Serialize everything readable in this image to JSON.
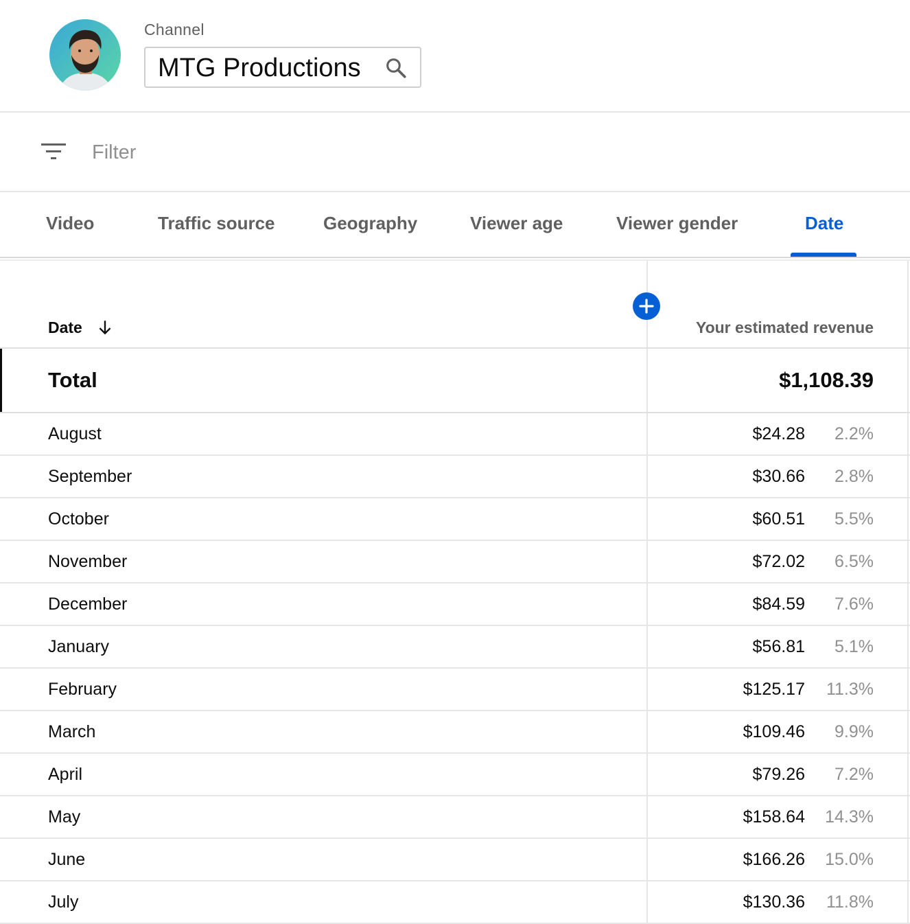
{
  "channel": {
    "label": "Channel",
    "name": "MTG Productions"
  },
  "filter": {
    "placeholder": "Filter"
  },
  "tabs": [
    {
      "label": "Video"
    },
    {
      "label": "Traffic source"
    },
    {
      "label": "Geography"
    },
    {
      "label": "Viewer age"
    },
    {
      "label": "Viewer gender"
    },
    {
      "label": "Date",
      "active": true
    }
  ],
  "table": {
    "date_header": "Date",
    "revenue_header": "Your estimated revenue",
    "total_label": "Total",
    "total_value": "$1,108.39",
    "rows": [
      {
        "label": "August",
        "value": "$24.28",
        "percent": "2.2%"
      },
      {
        "label": "September",
        "value": "$30.66",
        "percent": "2.8%"
      },
      {
        "label": "October",
        "value": "$60.51",
        "percent": "5.5%"
      },
      {
        "label": "November",
        "value": "$72.02",
        "percent": "6.5%"
      },
      {
        "label": "December",
        "value": "$84.59",
        "percent": "7.6%"
      },
      {
        "label": "January",
        "value": "$56.81",
        "percent": "5.1%"
      },
      {
        "label": "February",
        "value": "$125.17",
        "percent": "11.3%"
      },
      {
        "label": "March",
        "value": "$109.46",
        "percent": "9.9%"
      },
      {
        "label": "April",
        "value": "$79.26",
        "percent": "7.2%"
      },
      {
        "label": "May",
        "value": "$158.64",
        "percent": "14.3%"
      },
      {
        "label": "June",
        "value": "$166.26",
        "percent": "15.0%"
      },
      {
        "label": "July",
        "value": "$130.36",
        "percent": "11.8%"
      }
    ]
  },
  "colors": {
    "accent": "#065fd4",
    "text_primary": "#0d0d0d",
    "text_secondary": "#606060",
    "text_muted": "#909090"
  },
  "icons": {
    "channel_search": "search-icon",
    "filter": "filter-icon",
    "sort": "arrow-down-icon",
    "add_column": "plus-icon"
  }
}
